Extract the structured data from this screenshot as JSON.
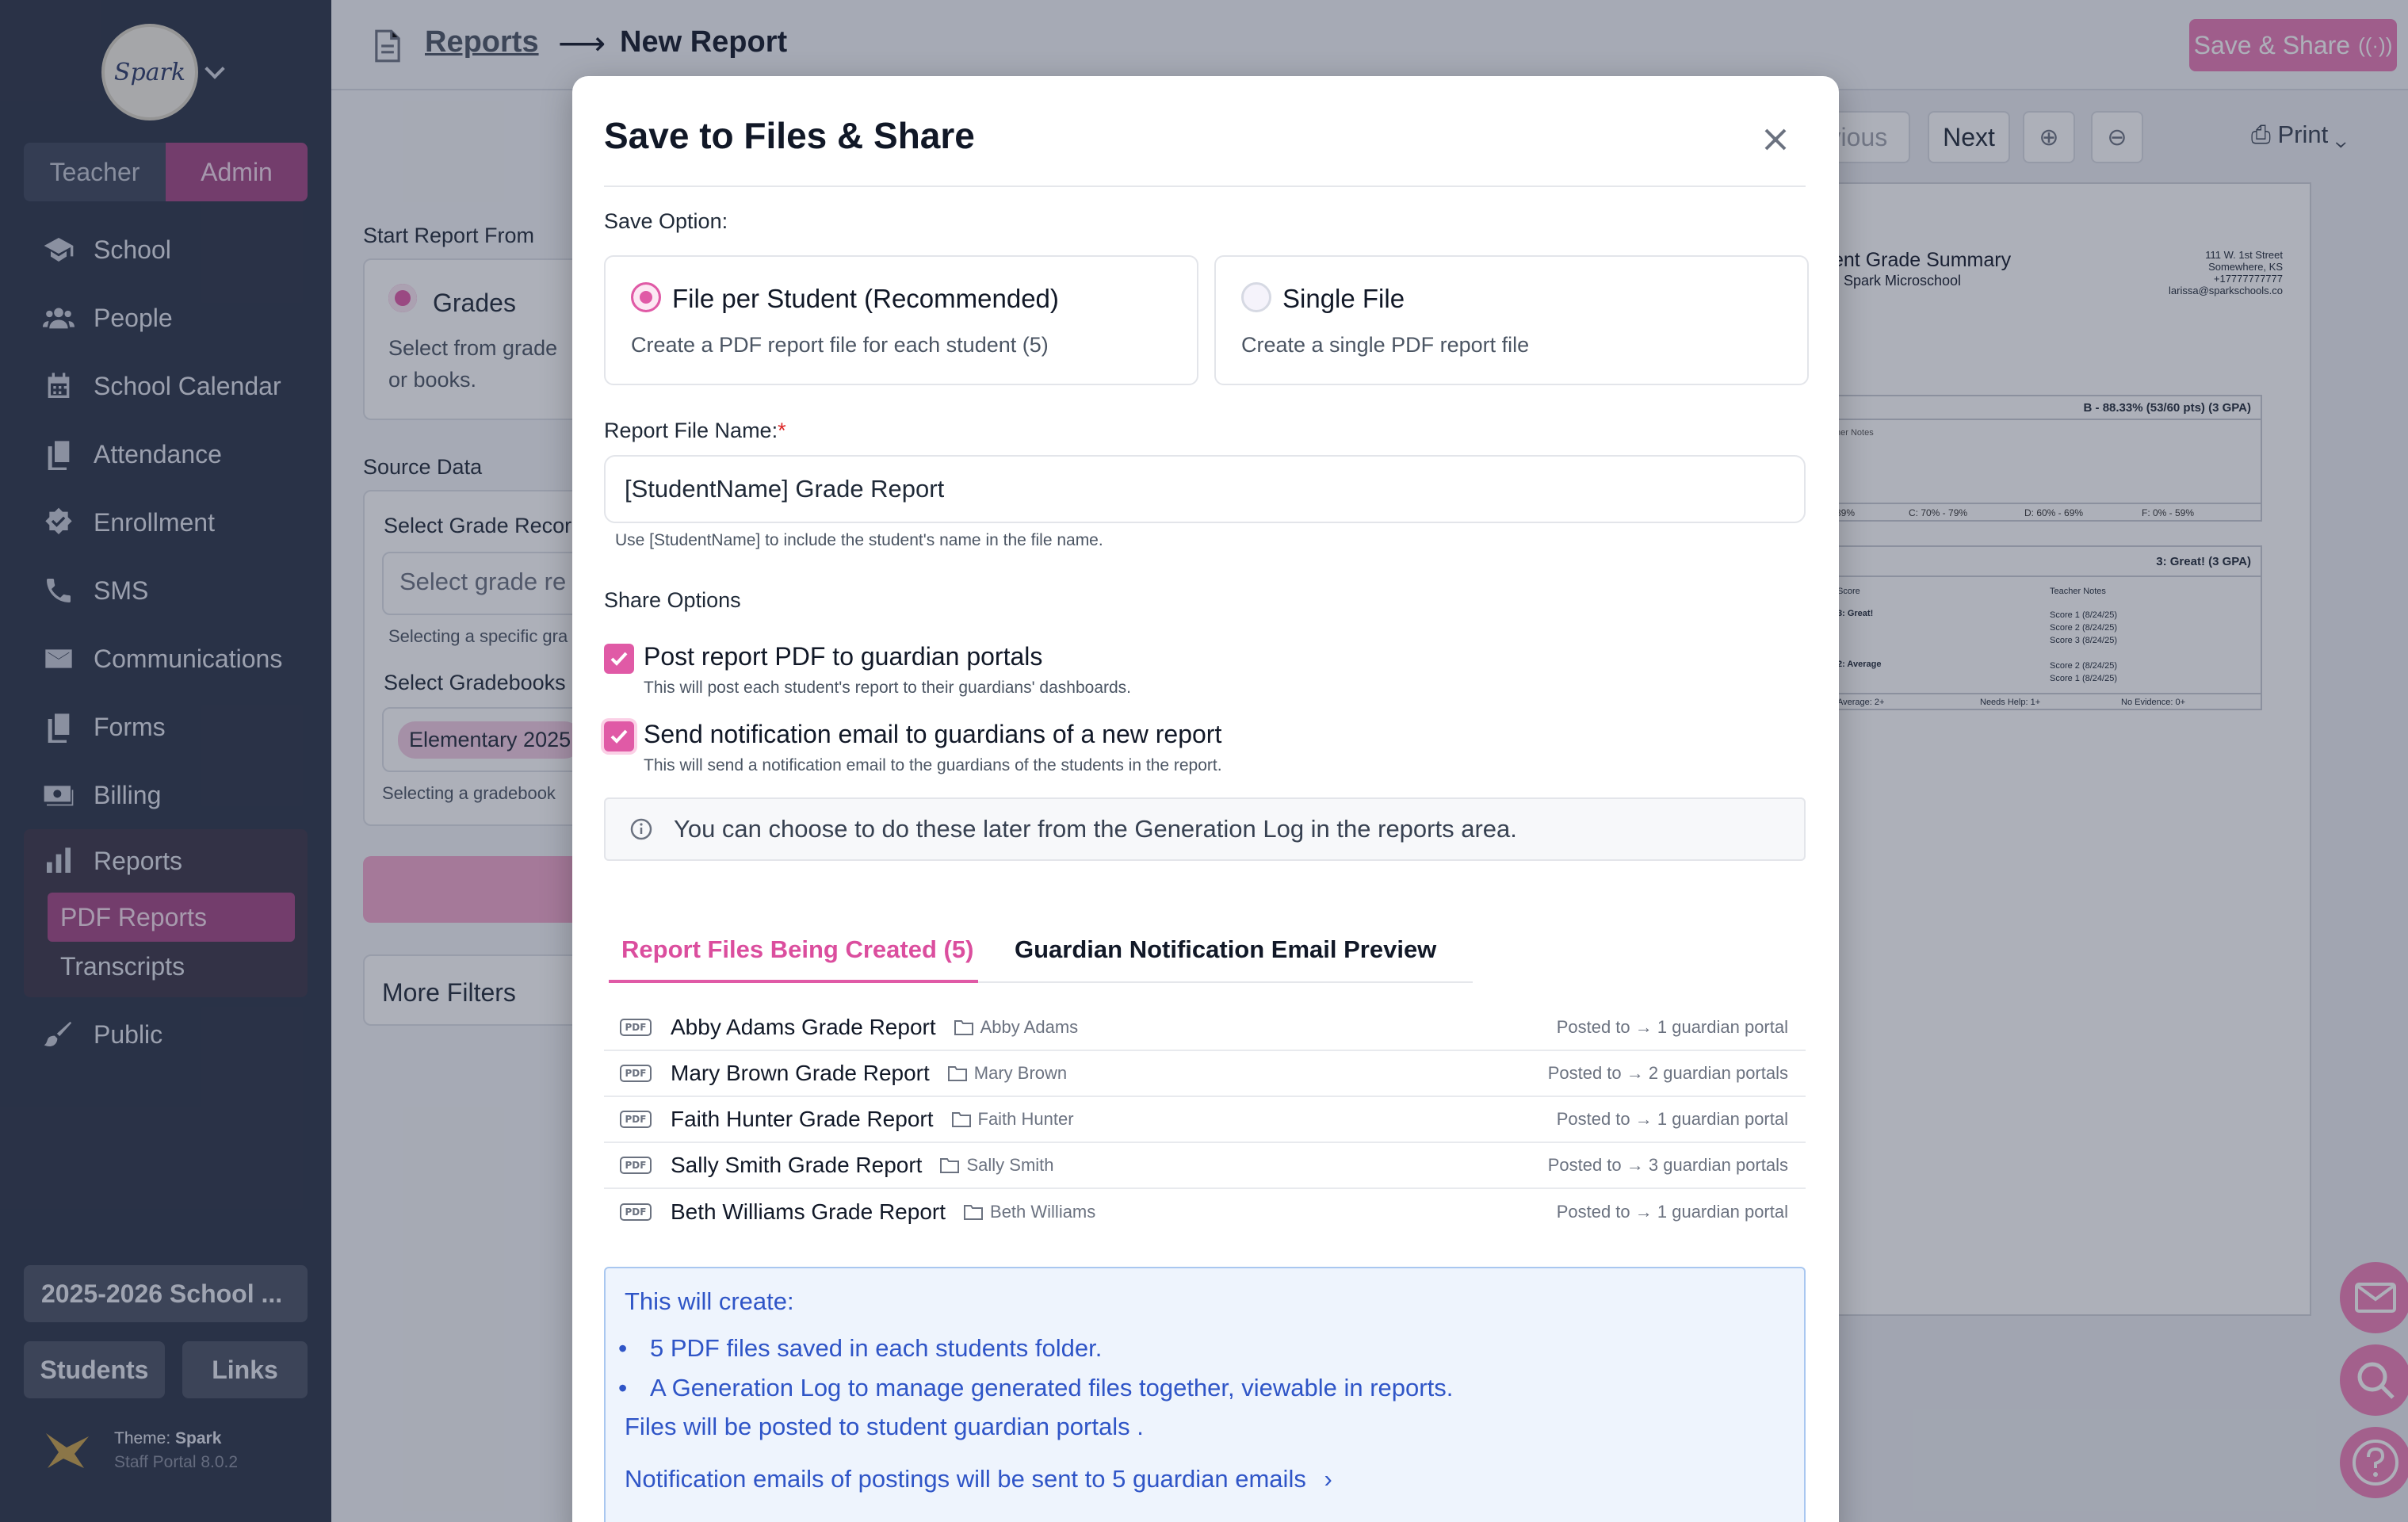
{
  "sidebar": {
    "logo_text": "Spark",
    "role_toggle": {
      "teacher": "Teacher",
      "admin": "Admin"
    },
    "nav": [
      {
        "label": "School",
        "icon": "school-icon"
      },
      {
        "label": "People",
        "icon": "people-icon"
      },
      {
        "label": "School Calendar",
        "icon": "calendar-icon"
      },
      {
        "label": "Attendance",
        "icon": "attendance-icon"
      },
      {
        "label": "Enrollment",
        "icon": "enrollment-icon"
      },
      {
        "label": "SMS",
        "icon": "phone-icon"
      },
      {
        "label": "Communications",
        "icon": "mail-icon"
      },
      {
        "label": "Forms",
        "icon": "forms-icon"
      },
      {
        "label": "Billing",
        "icon": "billing-icon"
      }
    ],
    "reports": {
      "label": "Reports",
      "icon": "bar-chart-icon",
      "sub": [
        "PDF Reports",
        "Transcripts"
      ]
    },
    "public": {
      "label": "Public",
      "icon": "brush-icon"
    },
    "school_year": "2025-2026 School ...",
    "students_btn": "Students",
    "links_btn": "Links",
    "theme_label": "Theme:",
    "theme_name": "Spark",
    "version": "Staff Portal 8.0.2"
  },
  "header": {
    "breadcrumb_parent": "Reports",
    "breadcrumb_arrow": "⟶",
    "breadcrumb_current": "New Report",
    "save_share_label": "Save & Share"
  },
  "background_form": {
    "start_from_label": "Start Report From",
    "grades_option": "Grades",
    "grades_desc_1": "Select from grade",
    "grades_desc_2": "or books.",
    "source_data_label": "Source Data",
    "select_grade_records_label": "Select Grade Recor",
    "select_grade_placeholder": "Select grade re",
    "selecting_specific": "Selecting a specific gra",
    "select_gradebooks_label": "Select Gradebooks",
    "gradebook_chip": "Elementary 2025",
    "selecting_gradebook": "Selecting a gradebook",
    "more_filters": "More Filters"
  },
  "doc_toolbar": {
    "previous": "evious",
    "next": "Next",
    "print": "Print"
  },
  "doc_preview": {
    "title": "ent Grade Summary",
    "school": "Spark Microschool",
    "address_1": "111 W. 1st Street",
    "address_2": "Somewhere, KS",
    "phone": "+17777777777",
    "email": "larissa@sparkschools.co",
    "box1_grade": "B - 88.33% (53/60 pts)  (3 GPA)",
    "box1_notes": "her Notes",
    "box1_scale": [
      "89%",
      "C: 70% - 79%",
      "D: 60% - 69%",
      "F: 0% - 59%"
    ],
    "box2_grade": "3: Great!  (3 GPA)",
    "box2_col1": "Score",
    "box2_col2": "Teacher Notes",
    "box2_r1": "3: Great!",
    "box2_r2": "2: Average",
    "box2_scores": [
      "Score 1 (8/24/25)",
      "Score 2 (8/24/25)",
      "Score 3 (8/24/25)",
      "Score 2 (8/24/25)",
      "Score 1 (8/24/25)"
    ],
    "box2_footer": [
      "Average: 2+",
      "Needs Help: 1+",
      "No Evidence: 0+"
    ]
  },
  "modal": {
    "title": "Save to Files & Share",
    "save_option_label": "Save Option:",
    "options": [
      {
        "title": "File per Student (Recommended)",
        "desc": "Create a PDF report file for each student (5)",
        "selected": true
      },
      {
        "title": "Single File",
        "desc": "Create a single PDF report file",
        "selected": false
      }
    ],
    "file_name_label": "Report File Name:",
    "required_mark": "*",
    "file_name_value": "[StudentName] Grade Report",
    "file_name_hint": "Use [StudentName] to include the student's name in the file name.",
    "share_options_label": "Share Options",
    "share_options": [
      {
        "title": "Post report PDF to guardian portals",
        "desc": "This will post each student's report to their guardians' dashboards.",
        "checked": true
      },
      {
        "title": "Send notification email to guardians of a new report",
        "desc": "This will send a notification email to the guardians of the students in the report.",
        "checked": true
      }
    ],
    "info_text": "You can choose to do these later from the Generation Log in the reports area.",
    "tabs": [
      "Report Files Being Created (5)",
      "Guardian Notification Email Preview"
    ],
    "pdf_badge": "PDF",
    "files": [
      {
        "name": "Abby Adams Grade Report",
        "folder": "Abby Adams",
        "posted": "Posted to → 1 guardian portal"
      },
      {
        "name": "Mary Brown Grade Report",
        "folder": "Mary Brown",
        "posted": "Posted to → 2 guardian portals"
      },
      {
        "name": "Faith Hunter Grade Report",
        "folder": "Faith Hunter",
        "posted": "Posted to → 1 guardian portal"
      },
      {
        "name": "Sally Smith Grade Report",
        "folder": "Sally Smith",
        "posted": "Posted to → 3 guardian portals"
      },
      {
        "name": "Beth Williams Grade Report",
        "folder": "Beth Williams",
        "posted": "Posted to → 1 guardian portal"
      }
    ],
    "summary": {
      "title": "This will create:",
      "bullets": [
        "5 PDF files saved in each students folder.",
        "A Generation Log to manage generated files together, viewable in reports."
      ],
      "posted_line": "Files will be posted to student guardian portals .",
      "email_line": "Notification emails of postings will be sent to 5 guardian emails"
    }
  },
  "colors": {
    "accent": "#e05aa6",
    "sidebar": "#2b3448",
    "info_blue": "#2f55c7"
  }
}
